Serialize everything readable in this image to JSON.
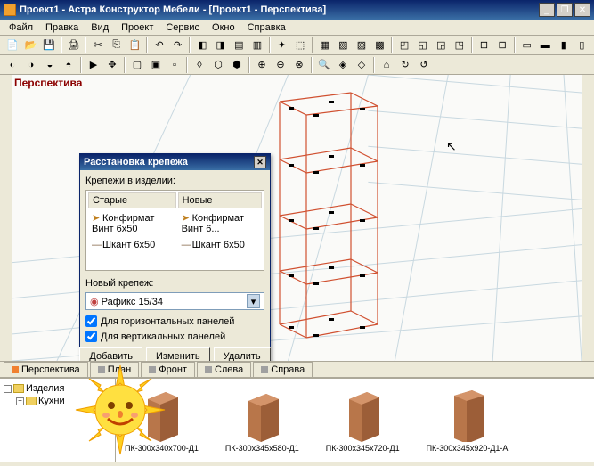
{
  "titlebar": {
    "text": "Проект1 - Астра Конструктор Мебели - [Проект1 - Перспектива]"
  },
  "menu": [
    "Файл",
    "Правка",
    "Вид",
    "Проект",
    "Сервис",
    "Окно",
    "Справка"
  ],
  "viewport": {
    "header": "Перспектива"
  },
  "dialog": {
    "title": "Расстановка крепежа",
    "fasteners_label": "Крепежи в изделии:",
    "col_old": "Старые",
    "col_new": "Новые",
    "rows": [
      {
        "old": "Конфирмат Винт 6x50",
        "new": "Конфирмат Винт 6..."
      },
      {
        "old": "Шкант 6x50",
        "new": "Шкант 6x50"
      }
    ],
    "new_fastener_label": "Новый крепеж:",
    "combo_value": "Рафикс 15/34",
    "chk_horiz": "Для горизонтальных панелей",
    "chk_vert": "Для вертикальных панелей",
    "btn_add": "Добавить",
    "btn_change": "Изменить",
    "btn_delete": "Удалить"
  },
  "tabs": [
    "Перспектива",
    "План",
    "Фронт",
    "Слева",
    "Справа"
  ],
  "tree": {
    "root": "Изделия",
    "child": "Кухни"
  },
  "thumbs": [
    "ПК-300x340x700-Д1",
    "ПК-300x345x580-Д1",
    "ПК-300x345x720-Д1",
    "ПК-300x345x920-Д1-А"
  ]
}
